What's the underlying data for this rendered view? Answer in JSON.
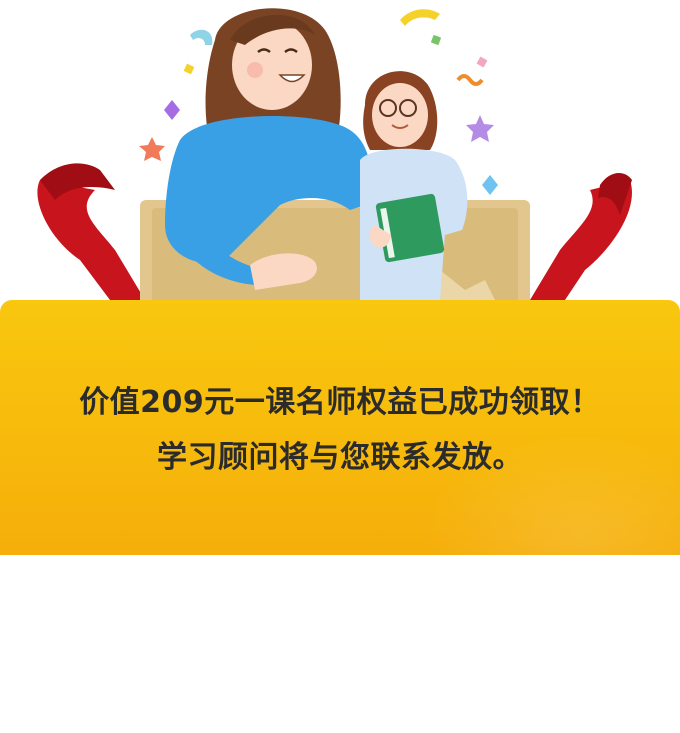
{
  "dialog": {
    "message_line1": "价值209元一课名师权益已成功领取！",
    "message_line2": "学习顾问将与您联系发放。"
  },
  "colors": {
    "banner": "#f8c70e",
    "text": "#2b2b2b",
    "ribbon": "#c8141c",
    "box": "#e0c58a",
    "sweater": "#3aa0e6"
  },
  "illustration": {
    "subject": "mother-and-daughter-with-book-celebration"
  }
}
